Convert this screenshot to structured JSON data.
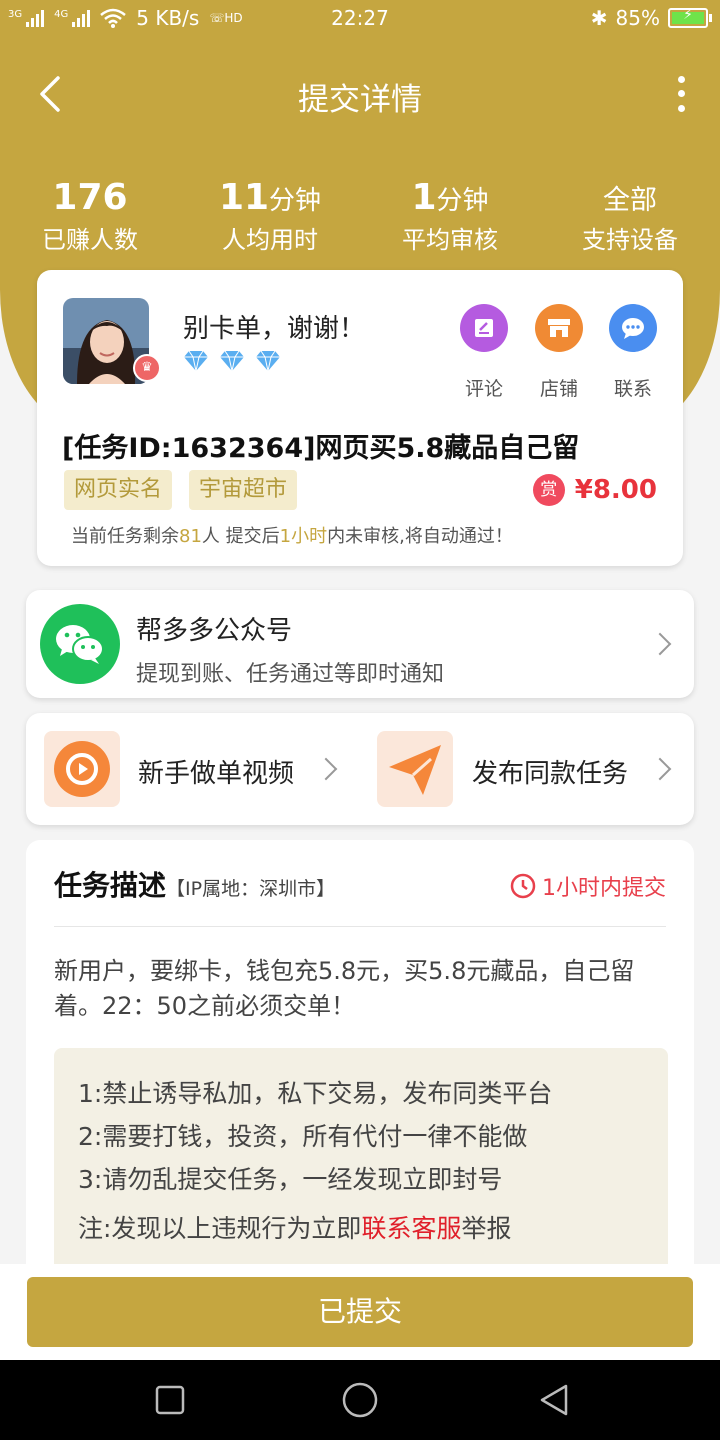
{
  "status_bar": {
    "signal1": "3G",
    "signal2": "4G",
    "speed": "5 KB/s",
    "hd": "HD",
    "time": "22:27",
    "battery": "85%"
  },
  "nav": {
    "title": "提交详情"
  },
  "stats": [
    {
      "value": "176",
      "unit": "",
      "label": "已赚人数"
    },
    {
      "value": "11",
      "unit": "分钟",
      "label": "人均用时"
    },
    {
      "value": "1",
      "unit": "分钟",
      "label": "平均审核"
    },
    {
      "value": "",
      "unit": "全部",
      "label": "支持设备"
    }
  ],
  "task": {
    "publisher_name": "别卡单，谢谢！",
    "actions": [
      {
        "label": "评论",
        "color": "#b55be0",
        "icon": "comment-icon"
      },
      {
        "label": "店铺",
        "color": "#f08a34",
        "icon": "store-icon"
      },
      {
        "label": "联系",
        "color": "#4a8ef0",
        "icon": "chat-icon"
      }
    ],
    "title": "[任务ID:1632364]网页买5.8藏品自己留",
    "tags": [
      "网页实名",
      "宇宙超市"
    ],
    "reward_badge": "赏",
    "price": "¥8.00",
    "remain_prefix": "当前任务剩余",
    "remain_count": "81",
    "remain_mid": "人  提交后",
    "remain_time": "1小时",
    "remain_suffix": "内未审核,将自动通过！"
  },
  "wechat": {
    "title": "帮多多公众号",
    "subtitle": "提现到账、任务通过等即时通知"
  },
  "links": {
    "video": "新手做单视频",
    "publish": "发布同款任务"
  },
  "description": {
    "title": "任务描述",
    "ip": "【IP属地：深圳市】",
    "deadline": "1小时内提交",
    "text": "新用户，要绑卡，钱包充5.8元，买5.8元藏品，自己留着。22：50之前必须交单！",
    "rules": [
      "1:禁止诱导私加，私下交易，发布同类平台",
      "2:需要打钱，投资，所有代付一律不能做",
      "3:请勿乱提交任务，一经发现立即封号"
    ],
    "note_prefix": "注:发现以上违规行为立即",
    "note_link": "联系客服",
    "note_suffix": "举报"
  },
  "submit": {
    "label": "已提交"
  },
  "colors": {
    "brand": "#c5a640",
    "danger": "#e8333c",
    "wechat": "#1fc05a"
  }
}
